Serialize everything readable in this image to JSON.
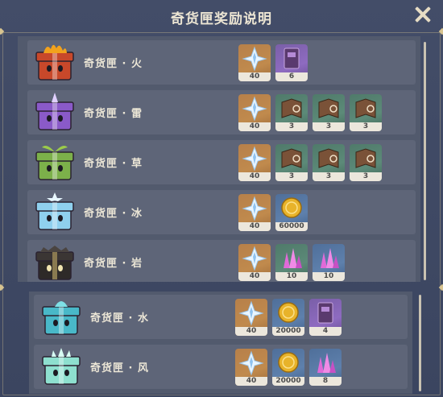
{
  "title": "奇货匣奖励说明",
  "rows": [
    {
      "name": "奇货匣 · 火",
      "element": "fire",
      "rewards": [
        {
          "icon": "primogem-icon",
          "bg": "gold",
          "count": "40"
        },
        {
          "icon": "book-icon",
          "bg": "purple",
          "count": "6"
        }
      ]
    },
    {
      "name": "奇货匣 · 雷",
      "element": "electro",
      "rewards": [
        {
          "icon": "primogem-icon",
          "bg": "gold",
          "count": "40"
        },
        {
          "icon": "talent-book-icon",
          "bg": "green",
          "count": "3"
        },
        {
          "icon": "talent-book-icon",
          "bg": "green",
          "count": "3"
        },
        {
          "icon": "talent-book-icon",
          "bg": "green",
          "count": "3"
        }
      ]
    },
    {
      "name": "奇货匣 · 草",
      "element": "dendro",
      "rewards": [
        {
          "icon": "primogem-icon",
          "bg": "gold",
          "count": "40"
        },
        {
          "icon": "talent-book-icon",
          "bg": "green",
          "count": "3"
        },
        {
          "icon": "talent-book-icon",
          "bg": "green",
          "count": "3"
        },
        {
          "icon": "talent-book-icon",
          "bg": "green",
          "count": "3"
        }
      ]
    },
    {
      "name": "奇货匣 · 冰",
      "element": "cryo",
      "rewards": [
        {
          "icon": "primogem-icon",
          "bg": "gold",
          "count": "40"
        },
        {
          "icon": "mora-coin-icon",
          "bg": "blue",
          "count": "60000"
        }
      ]
    },
    {
      "name": "奇货匣 · 岩",
      "element": "geo",
      "rewards": [
        {
          "icon": "primogem-icon",
          "bg": "gold",
          "count": "40"
        },
        {
          "icon": "crystal-icon",
          "bg": "green",
          "count": "10"
        },
        {
          "icon": "crystal-icon",
          "bg": "blue",
          "count": "10"
        }
      ]
    },
    {
      "name": "奇货匣 · 水",
      "element": "hydro",
      "rewards": [
        {
          "icon": "primogem-icon",
          "bg": "gold",
          "count": "40"
        },
        {
          "icon": "mora-coin-icon",
          "bg": "blue",
          "count": "20000"
        },
        {
          "icon": "book-icon",
          "bg": "purple",
          "count": "4"
        }
      ]
    },
    {
      "name": "奇货匣 · 风",
      "element": "anemo",
      "rewards": [
        {
          "icon": "primogem-icon",
          "bg": "gold",
          "count": "40"
        },
        {
          "icon": "mora-coin-icon",
          "bg": "blue",
          "count": "20000"
        },
        {
          "icon": "crystal-icon",
          "bg": "blue",
          "count": "8"
        }
      ]
    }
  ],
  "colors": {
    "fire": "#c8482a",
    "electro": "#8a5ac8",
    "dendro": "#7cb04a",
    "cryo": "#8fd0ee",
    "geo": "#3a3532",
    "hydro": "#49b8c8",
    "anemo": "#8ee0cf"
  }
}
